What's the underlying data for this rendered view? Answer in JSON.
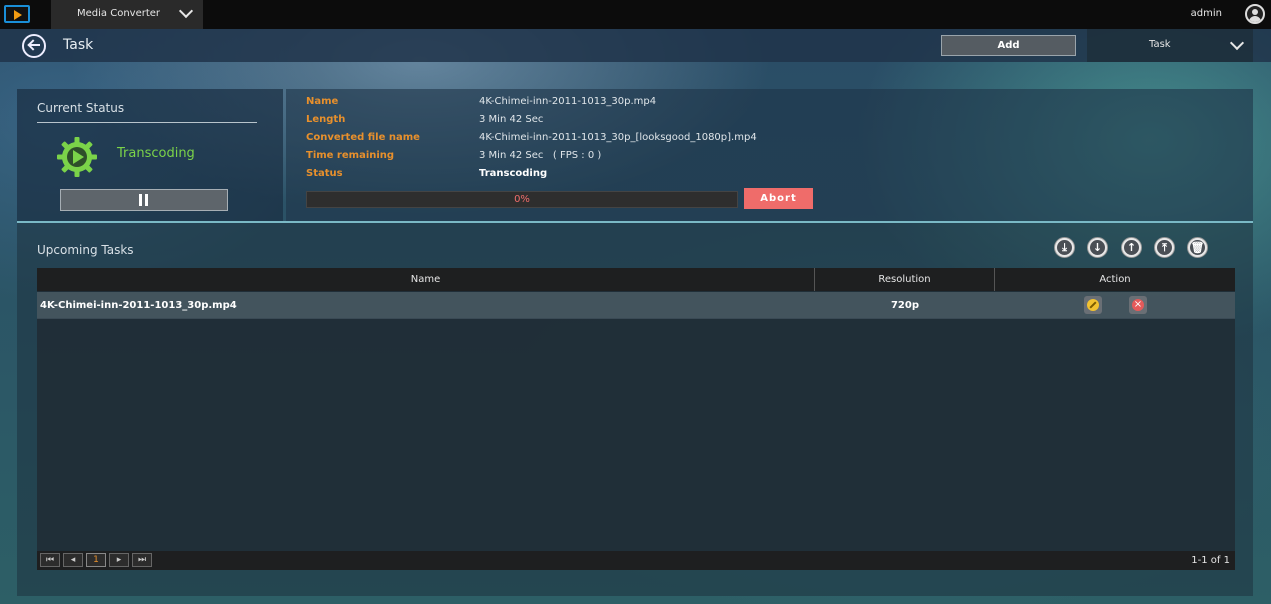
{
  "topbar": {
    "app_icon": "media-converter-logo",
    "app_name": "Media Converter",
    "user": "admin"
  },
  "header": {
    "title": "Task",
    "add_label": "Add",
    "filter_value": "Task"
  },
  "current_status": {
    "heading": "Current Status",
    "state": "Transcoding",
    "control_icon": "pause-icon"
  },
  "details": {
    "name_label": "Name",
    "name_value": "4K-Chimei-inn-2011-1013_30p.mp4",
    "length_label": "Length",
    "length_value": "3 Min 42 Sec",
    "converted_label": "Converted file name",
    "converted_value": "4K-Chimei-inn-2011-1013_30p_[looksgood_1080p].mp4",
    "remaining_label": "Time remaining",
    "remaining_value": "3 Min 42 Sec   ( FPS : 0 )",
    "status_label": "Status",
    "status_value": "Transcoding",
    "progress_percent": 0,
    "progress_text": "0%",
    "abort_label": "Abort"
  },
  "upcoming": {
    "heading": "Upcoming Tasks",
    "controls": [
      "move-to-bottom-icon",
      "move-down-icon",
      "move-up-icon",
      "move-to-top-icon",
      "trash-icon"
    ],
    "columns": [
      "Name",
      "Resolution",
      "Action"
    ],
    "rows": [
      {
        "name": "4K-Chimei-inn-2011-1013_30p.mp4",
        "resolution": "720p"
      }
    ],
    "pager": {
      "current_page": "1",
      "info": "1-1 of 1"
    }
  },
  "colors": {
    "accent_orange": "#e8902c",
    "transcoding_green": "#7bd349",
    "abort_red": "#ef6c6a"
  }
}
